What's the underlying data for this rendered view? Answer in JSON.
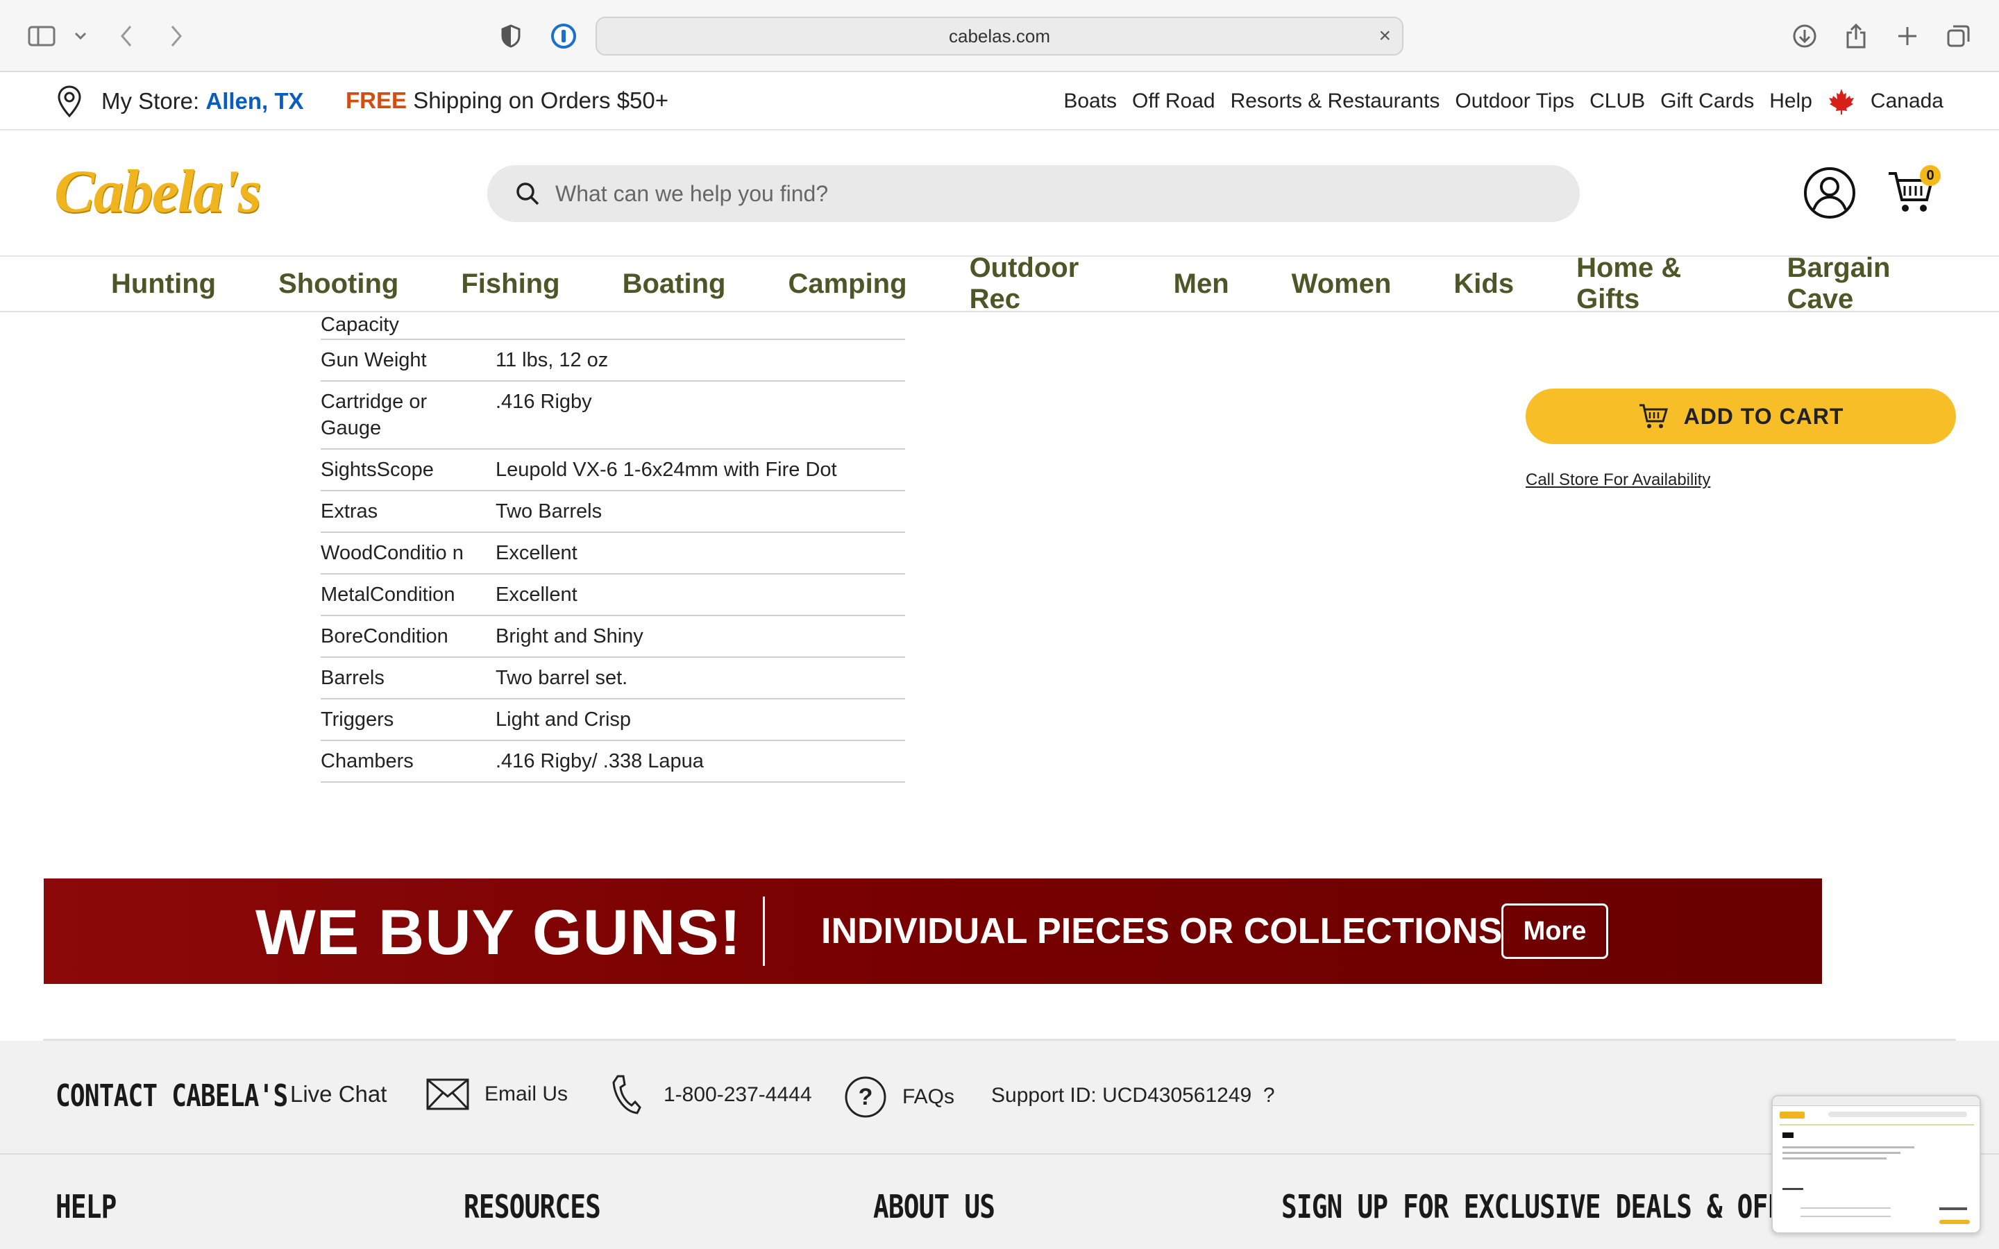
{
  "browser": {
    "url": "cabelas.com"
  },
  "utility_bar": {
    "store_label": "My Store:",
    "store_name": "Allen, TX",
    "free": "FREE",
    "shipping": "Shipping on Orders $50+",
    "links": [
      "Boats",
      "Off Road",
      "Resorts & Restaurants",
      "Outdoor Tips",
      "CLUB",
      "Gift Cards",
      "Help"
    ],
    "country": "Canada"
  },
  "header": {
    "logo_text": "Cabela's",
    "search_placeholder": "What can we help you find?",
    "cart_count": "0"
  },
  "nav": [
    "Hunting",
    "Shooting",
    "Fishing",
    "Boating",
    "Camping",
    "Outdoor Rec",
    "Men",
    "Women",
    "Kids",
    "Home & Gifts",
    "Bargain Cave"
  ],
  "specs": {
    "partial_row": "Capacity",
    "rows": [
      {
        "k": "Gun Weight",
        "v": "11 lbs, 12 oz"
      },
      {
        "k": "Cartridge or Gauge",
        "v": ".416 Rigby"
      },
      {
        "k": "SightsScope",
        "v": "Leupold VX-6 1-6x24mm with Fire Dot"
      },
      {
        "k": "Extras",
        "v": "Two Barrels"
      },
      {
        "k": "WoodConditio n",
        "v": "Excellent"
      },
      {
        "k": "MetalCondition",
        "v": "Excellent"
      },
      {
        "k": "BoreCondition",
        "v": "Bright and Shiny"
      },
      {
        "k": "Barrels",
        "v": "Two barrel set."
      },
      {
        "k": "Triggers",
        "v": "Light and Crisp"
      },
      {
        "k": "Chambers",
        "v": ".416 Rigby/ .338 Lapua"
      }
    ]
  },
  "purchase": {
    "add_to_cart": "ADD TO CART",
    "call_store": "Call Store For Availability"
  },
  "banner": {
    "headline": "WE BUY GUNS!",
    "subline": "INDIVIDUAL PIECES OR COLLECTIONS",
    "more": "More"
  },
  "footer": {
    "contact_title": "CONTACT CABELA'S",
    "live_chat": "Live Chat",
    "email": "Email Us",
    "phone": "1-800-237-4444",
    "faqs": "FAQs",
    "support_id": "Support ID: UCD430561249",
    "support_q": "?",
    "columns": [
      "HELP",
      "RESOURCES",
      "ABOUT US",
      "SIGN UP FOR EXCLUSIVE DEALS & OFFERS"
    ]
  },
  "colors": {
    "brand_yellow": "#f0b51e",
    "nav_olive": "#4e5628",
    "store_blue": "#0a5cbf",
    "free_orange": "#d34c10",
    "banner_red": "#7a0000",
    "cart_yellow": "#f7be28"
  }
}
